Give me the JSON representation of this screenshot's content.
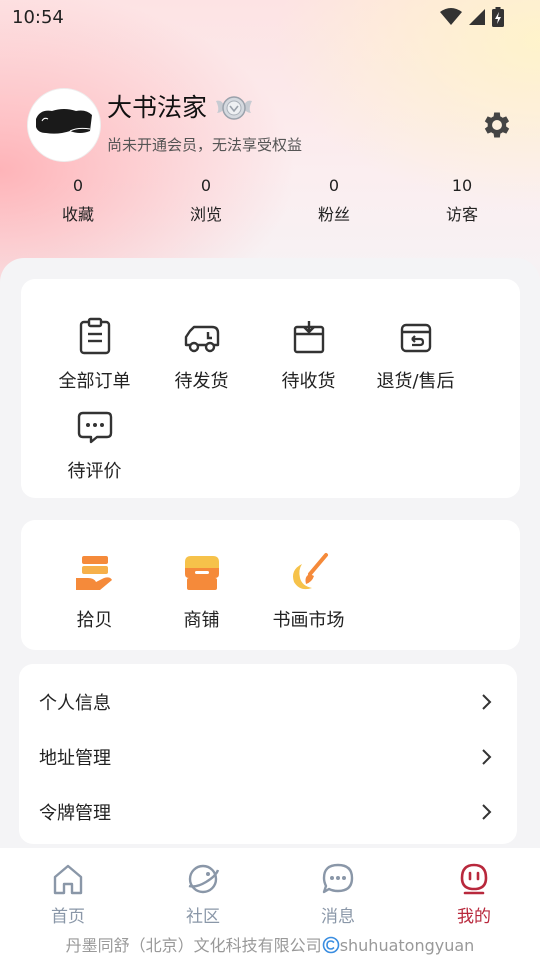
{
  "status_bar": {
    "time": "10:54"
  },
  "profile": {
    "username": "大书法家",
    "member_note": "尚未开通会员，无法享受权益"
  },
  "stats": [
    {
      "value": "0",
      "label": "收藏"
    },
    {
      "value": "0",
      "label": "浏览"
    },
    {
      "value": "0",
      "label": "粉丝"
    },
    {
      "value": "10",
      "label": "访客"
    }
  ],
  "orders": [
    {
      "label": "全部订单",
      "icon": "clipboard-icon"
    },
    {
      "label": "待发货",
      "icon": "truck-icon"
    },
    {
      "label": "待收货",
      "icon": "box-download-icon"
    },
    {
      "label": "退货/售后",
      "icon": "return-box-icon"
    },
    {
      "label": "待评价",
      "icon": "chat-dots-icon"
    }
  ],
  "services": [
    {
      "label": "拾贝",
      "icon": "stack-hand-icon"
    },
    {
      "label": "商铺",
      "icon": "shop-icon"
    },
    {
      "label": "书画市场",
      "icon": "brush-icon"
    }
  ],
  "menu": [
    {
      "label": "个人信息"
    },
    {
      "label": "地址管理"
    },
    {
      "label": "令牌管理"
    }
  ],
  "tabs": [
    {
      "label": "首页",
      "icon": "home-icon",
      "active": false
    },
    {
      "label": "社区",
      "icon": "planet-icon",
      "active": false
    },
    {
      "label": "消息",
      "icon": "message-icon",
      "active": false
    },
    {
      "label": "我的",
      "icon": "profile-face-icon",
      "active": true
    }
  ],
  "footer": {
    "text": "丹墨同舒（北京）文化科技有限公司",
    "brand": "shuhuatongyuan"
  },
  "colors": {
    "accent": "#b8283c",
    "tab_inactive": "#8a97a8",
    "service_orange": "#f58a3a",
    "service_yellow": "#f6c24a"
  }
}
